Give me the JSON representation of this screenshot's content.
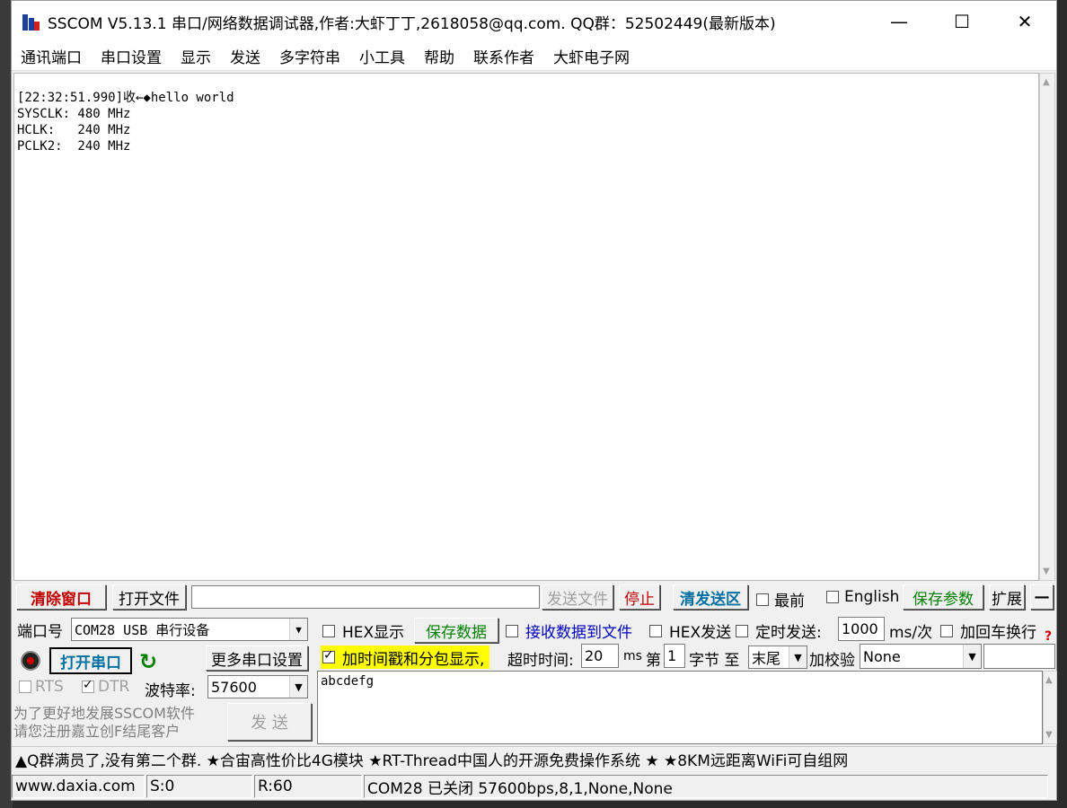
{
  "window": {
    "title": "SSCOM V5.13.1 串口/网络数据调试器,作者:大虾丁丁,2618058@qq.com. QQ群：52502449(最新版本)",
    "minimize": "—",
    "maximize": "☐",
    "close": "✕"
  },
  "menu": [
    "通讯端口",
    "串口设置",
    "显示",
    "发送",
    "多字符串",
    "小工具",
    "帮助",
    "联系作者",
    "大虾电子网"
  ],
  "receive": {
    "lines": [
      "[22:32:51.990]收←◆hello world",
      "SYSCLK: 480 MHz",
      "HCLK:   240 MHz",
      "PCLK2:  240 MHz"
    ]
  },
  "toolbar": {
    "clear_window": "清除窗口",
    "open_file": "打开文件",
    "file_path": "",
    "send_file": "发送文件",
    "stop": "停止",
    "clear_send": "清发送区",
    "topmost": "最前",
    "english": "English",
    "save_params": "保存参数",
    "expand": "扩展",
    "collapse": "—"
  },
  "port": {
    "label": "端口号",
    "value": "COM28 USB 串行设备",
    "open_button": "打开串口",
    "more_settings": "更多串口设置",
    "rts": "RTS",
    "dtr": "DTR",
    "baud_label": "波特率:",
    "baud_value": "57600",
    "promo_line1": "为了更好地发展SSCOM软件",
    "promo_line2": "请您注册嘉立创F结尾客户",
    "send_button": "发  送"
  },
  "options": {
    "hex_display": "HEX显示",
    "save_data": "保存数据",
    "recv_to_file": "接收数据到文件",
    "hex_send": "HEX发送",
    "timed_send": "定时发送:",
    "interval": "1000",
    "interval_unit": "ms/次",
    "add_crlf": "加回车换行",
    "timestamp": "加时间戳和分包显示,",
    "timeout_label": "超时时间:",
    "timeout_value": "20",
    "timeout_unit": "ms",
    "byte_prefix": "第",
    "byte_value": "1",
    "byte_suffix": "字节 至",
    "end_value": "末尾",
    "checksum_label": "加校验",
    "checksum_value": "None"
  },
  "send": {
    "text": "abcdefg"
  },
  "ticker": "▲Q群满员了,没有第二个群. ★合宙高性价比4G模块 ★RT-Thread中国人的开源免费操作系统 ★ ★8KM远距离WiFi可自组网",
  "status": {
    "site": "www.daxia.com",
    "sent": "S:0",
    "received": "R:60",
    "port_state": "COM28 已关闭  57600bps,8,1,None,None"
  },
  "colors": {
    "clear_window": "#c00000",
    "open_port": "#0070a0",
    "green_text": "#008000",
    "blue_text": "#0000c0",
    "highlight": "#ffff00"
  }
}
